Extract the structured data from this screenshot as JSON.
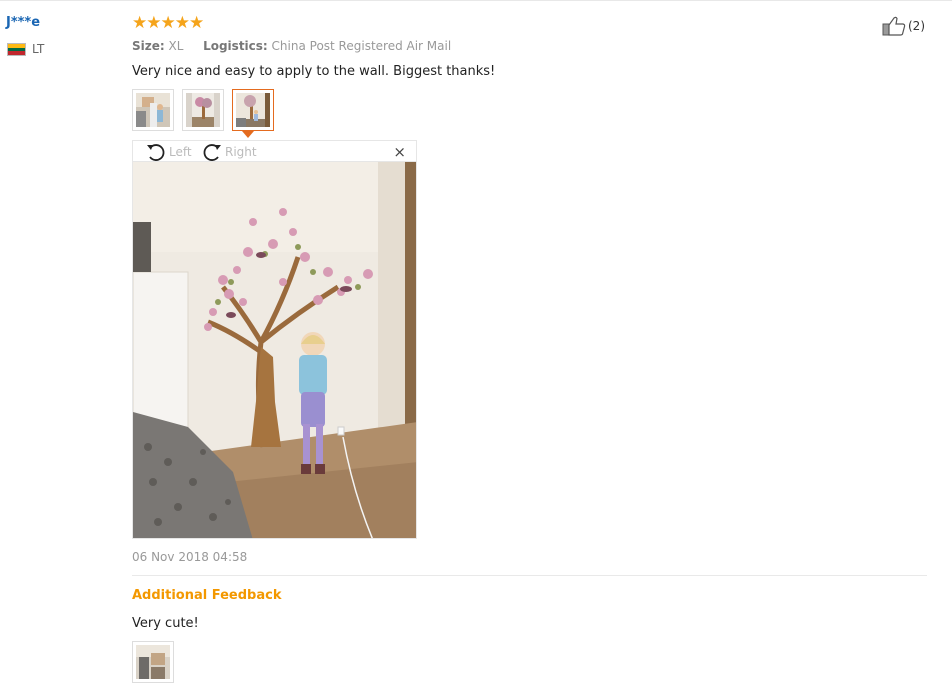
{
  "review": {
    "user": "J***e",
    "country_code": "LT",
    "flag_colors": [
      "#fdb913",
      "#006a44",
      "#c1272d"
    ],
    "stars": "★★★★★",
    "rating": 5,
    "size_label": "Size:",
    "size_value": "XL",
    "logistics_label": "Logistics:",
    "logistics_value": "China Post Registered Air Mail",
    "helpful_count": "(2)",
    "text": "Very nice and easy to apply to the wall. Biggest thanks!",
    "photos": [
      {
        "icon": "photo-thumbnail-1"
      },
      {
        "icon": "photo-thumbnail-2"
      },
      {
        "icon": "photo-thumbnail-3",
        "active": true
      }
    ],
    "viewer": {
      "rotate_left": "Left",
      "rotate_right": "Right",
      "close": "×"
    },
    "date": "06 Nov 2018 04:58"
  },
  "additional": {
    "title": "Additional Feedback",
    "text": "Very cute!"
  },
  "colors": {
    "accent_orange": "#f39800",
    "star": "#f5a41b",
    "user_link": "#1a66b3",
    "active_border": "#e46b1f"
  }
}
